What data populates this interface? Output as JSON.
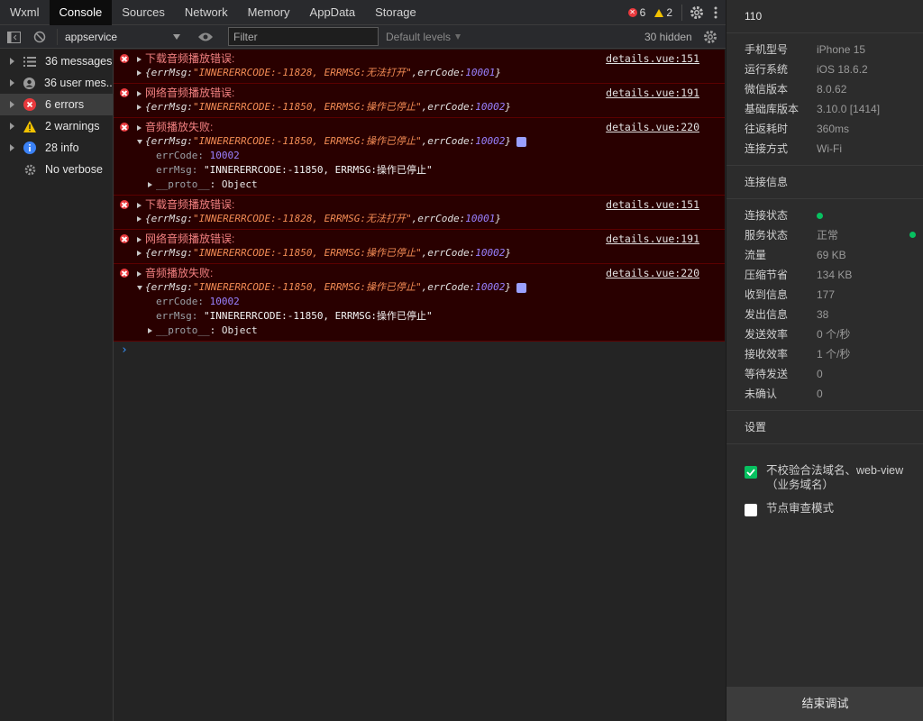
{
  "tabs": [
    {
      "label": "Wxml",
      "active": false
    },
    {
      "label": "Console",
      "active": true
    },
    {
      "label": "Sources",
      "active": false
    },
    {
      "label": "Network",
      "active": false
    },
    {
      "label": "Memory",
      "active": false
    },
    {
      "label": "AppData",
      "active": false
    },
    {
      "label": "Storage",
      "active": false
    }
  ],
  "counters": {
    "errors": "6",
    "warnings": "2"
  },
  "toolbar": {
    "context": "appservice",
    "filter_placeholder": "Filter",
    "levels": "Default levels",
    "hidden": "30 hidden"
  },
  "sidebar": [
    {
      "label": "36 messages",
      "icon": "list-icon",
      "selected": false
    },
    {
      "label": "36 user mes...",
      "icon": "user-icon",
      "selected": false
    },
    {
      "label": "6 errors",
      "icon": "error-icon",
      "selected": true
    },
    {
      "label": "2 warnings",
      "icon": "warning-icon",
      "selected": false
    },
    {
      "label": "28 info",
      "icon": "info-icon",
      "selected": false
    },
    {
      "label": "No verbose",
      "icon": "gear-icon",
      "selected": false
    }
  ],
  "entries": [
    {
      "msg": "下载音频播放错误:",
      "source": "details.vue:151",
      "errMsg": "\"INNERERRCODE:-11828, ERRMSG:无法打开\"",
      "errCode": "10001",
      "expanded": false
    },
    {
      "msg": "网络音频播放错误:",
      "source": "details.vue:191",
      "errMsg": "\"INNERERRCODE:-11850, ERRMSG:操作已停止\"",
      "errCode": "10002",
      "expanded": false
    },
    {
      "msg": "音频播放失败:",
      "source": "details.vue:220",
      "errMsg": "\"INNERERRCODE:-11850, ERRMSG:操作已停止\"",
      "errCode": "10002",
      "expanded": true
    },
    {
      "msg": "下载音频播放错误:",
      "source": "details.vue:151",
      "errMsg": "\"INNERERRCODE:-11828, ERRMSG:无法打开\"",
      "errCode": "10001",
      "expanded": false
    },
    {
      "msg": "网络音频播放错误:",
      "source": "details.vue:191",
      "errMsg": "\"INNERERRCODE:-11850, ERRMSG:操作已停止\"",
      "errCode": "10002",
      "expanded": false
    },
    {
      "msg": "音频播放失败:",
      "source": "details.vue:220",
      "errMsg": "\"INNERERRCODE:-11850, ERRMSG:操作已停止\"",
      "errCode": "10002",
      "expanded": true
    }
  ],
  "console_text": {
    "open_brace": "{",
    "close_brace": "}",
    "errMsg_key": "errMsg: ",
    "errCode_key": "errCode: ",
    "comma": ", ",
    "prop_errCode": "errCode: ",
    "prop_errMsg": "errMsg: ",
    "proto_key": "__proto__",
    "proto_val": ": Object",
    "prompt": "›"
  },
  "right_panel": {
    "id": "110",
    "device": [
      {
        "label": "手机型号",
        "value": "iPhone 15"
      },
      {
        "label": "运行系统",
        "value": "iOS 18.6.2"
      },
      {
        "label": "微信版本",
        "value": "8.0.62"
      },
      {
        "label": "基础库版本",
        "value": "3.10.0 [1414]"
      },
      {
        "label": "往返耗时",
        "value": "360ms"
      },
      {
        "label": "连接方式",
        "value": "Wi-Fi"
      }
    ],
    "conn_title": "连接信息",
    "conn": [
      {
        "label": "连接状态",
        "value": "",
        "dot": true
      },
      {
        "label": "服务状态",
        "value": "正常",
        "dot": true
      },
      {
        "label": "流量",
        "value": "69 KB"
      },
      {
        "label": "压缩节省",
        "value": "134 KB"
      },
      {
        "label": "收到信息",
        "value": "177"
      },
      {
        "label": "发出信息",
        "value": "38"
      },
      {
        "label": "发送效率",
        "value": "0 个/秒"
      },
      {
        "label": "接收效率",
        "value": "1 个/秒"
      },
      {
        "label": "等待发送",
        "value": "0"
      },
      {
        "label": "未确认",
        "value": "0"
      }
    ],
    "settings_title": "设置",
    "settings": [
      {
        "label": "不校验合法域名、web-view（业务域名）",
        "checked": true
      },
      {
        "label": "节点审查模式",
        "checked": false
      }
    ],
    "end_button": "结束调试"
  },
  "colors": {
    "accent": "#07c160",
    "error": "#e8393d",
    "warning": "#f2c200",
    "info": "#3794ff"
  }
}
